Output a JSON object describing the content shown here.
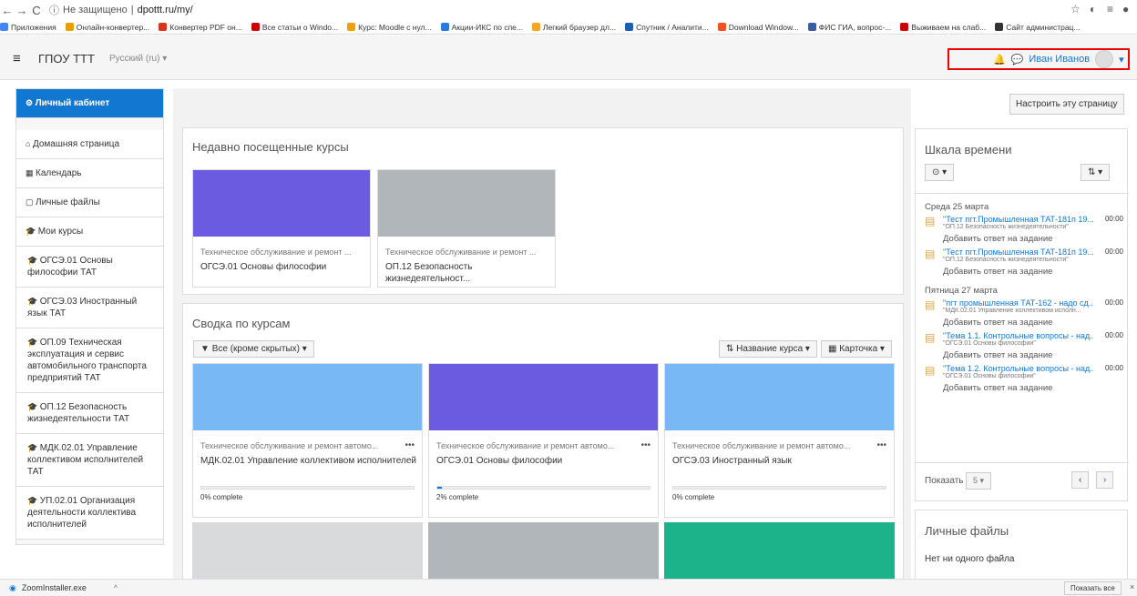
{
  "browser": {
    "insecure_label": "Не защищено",
    "url": "dpottt.ru/my/",
    "bookmarks": [
      {
        "label": "Приложения",
        "color": "#4285f4"
      },
      {
        "label": "Онлайн-конвертер...",
        "color": "#e8a000"
      },
      {
        "label": "Конвертер PDF он...",
        "color": "#d9341b"
      },
      {
        "label": "Все статьи о Windo...",
        "color": "#c00"
      },
      {
        "label": "Курс: Moodle с нул...",
        "color": "#f0a000"
      },
      {
        "label": "Акции-ИКС по спе...",
        "color": "#2a7ae2"
      },
      {
        "label": "Легкий браузер дл...",
        "color": "#f5a623"
      },
      {
        "label": "Спутник / Аналити...",
        "color": "#1a5fb4"
      },
      {
        "label": "Download Window...",
        "color": "#f25022"
      },
      {
        "label": "ФИС ГИА, вопрос-...",
        "color": "#3a5da8"
      },
      {
        "label": "Выживаем на слаб...",
        "color": "#c00"
      },
      {
        "label": "Сайт администрац...",
        "color": "#333"
      }
    ]
  },
  "header": {
    "menu_icon": "hamburger-icon",
    "site_name": "ГПОУ ТТТ",
    "language": "Русский (ru) ▾",
    "user_name": "Иван Иванов"
  },
  "sidebar": {
    "items": [
      {
        "label": "Личный кабинет",
        "icon": "dashboard-icon"
      },
      {
        "label": "Домашняя страница",
        "icon": "home-icon"
      },
      {
        "label": "Календарь",
        "icon": "calendar-icon"
      },
      {
        "label": "Личные файлы",
        "icon": "file-icon"
      },
      {
        "label": "Мои курсы",
        "icon": "graduation-cap-icon"
      },
      {
        "label": "ОГСЭ.01 Основы философии ТАТ",
        "icon": "graduation-cap-icon"
      },
      {
        "label": "ОГСЭ.03 Иностранный язык ТАТ",
        "icon": "graduation-cap-icon"
      },
      {
        "label": "ОП.09 Техническая эксплуатация и сервис автомобильного транспорта предприятий ТАТ",
        "icon": "graduation-cap-icon"
      },
      {
        "label": "ОП.12 Безопасность жизнедеятельности ТАТ",
        "icon": "graduation-cap-icon"
      },
      {
        "label": "МДК.02.01 Управление коллективом исполнителей ТАТ",
        "icon": "graduation-cap-icon"
      },
      {
        "label": "УП.02.01 Организация деятельности коллектива исполнителей",
        "icon": "graduation-cap-icon"
      }
    ]
  },
  "main": {
    "customize_button": "Настроить эту страницу",
    "recent": {
      "title": "Недавно посещенные курсы",
      "courses": [
        {
          "category": "Техническое обслуживание и ремонт ...",
          "name": "ОГСЭ.01 Основы философии",
          "color": "#6a5be0"
        },
        {
          "category": "Техническое обслуживание и ремонт ...",
          "name": "ОП.12 Безопасность жизнедеятельност...",
          "color": "#b0b6ba"
        }
      ]
    },
    "overview": {
      "title": "Сводка по курсам",
      "filter": "Все (кроме скрытых)",
      "sort": "Название курса",
      "view": "Карточка",
      "courses": [
        {
          "category": "Техническое обслуживание и ремонт автомо...",
          "name": "МДК.02.01 Управление коллективом исполнителей",
          "progress_text": "0% complete",
          "progress": 0,
          "color": "#78b8f5"
        },
        {
          "category": "Техническое обслуживание и ремонт автомо...",
          "name": "ОГСЭ.01 Основы философии",
          "progress_text": "2% complete",
          "progress": 2,
          "color": "#6a5be0"
        },
        {
          "category": "Техническое обслуживание и ремонт автомо...",
          "name": "ОГСЭ.03 Иностранный язык",
          "progress_text": "0% complete",
          "progress": 0,
          "color": "#78b8f5"
        }
      ],
      "bottom_colors": [
        "#d8dadc",
        "#b0b6ba",
        "#1db38a"
      ]
    }
  },
  "timeline": {
    "title": "Шкала времени",
    "groups": [
      {
        "date": "Среда 25 марта",
        "events": [
          {
            "title": "\"Тест пгт.Промышленная ТАТ-181п 19...",
            "course": "\"ОП.12 Безопасность жизнедеятельности\"",
            "time": "00:00",
            "action": "Добавить ответ на задание"
          },
          {
            "title": "\"Тест пгт.Промышленная ТАТ-181п 19...",
            "course": "\"ОП.12 Безопасность жизнедеятельности\"",
            "time": "00:00",
            "action": "Добавить ответ на задание"
          }
        ]
      },
      {
        "date": "Пятница 27 марта",
        "events": [
          {
            "title": "\"пгт промышленная ТАТ-162 - надо сд...",
            "course": "\"МДК.02.01 Управление коллективом исполн...",
            "time": "00:00",
            "action": "Добавить ответ на задание"
          },
          {
            "title": "\"Тема 1.1. Контрольные вопросы - над...",
            "course": "\"ОГСЭ.01 Основы философии\"",
            "time": "00:00",
            "action": "Добавить ответ на задание"
          },
          {
            "title": "\"Тема 1.2. Контрольные вопросы - над...",
            "course": "\"ОГСЭ.01 Основы философии\"",
            "time": "00:00",
            "action": "Добавить ответ на задание"
          }
        ]
      }
    ],
    "show_label": "Показать",
    "show_value": "5"
  },
  "files": {
    "title": "Личные файлы",
    "empty": "Нет ни одного файла"
  },
  "download_bar": {
    "file": "ZoomInstaller.exe",
    "show_all": "Показать все"
  }
}
